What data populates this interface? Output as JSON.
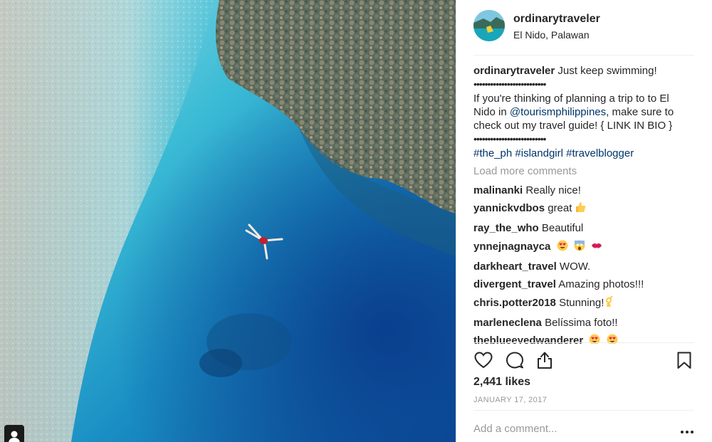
{
  "post": {
    "username": "ordinarytraveler",
    "location": "El Nido, Palawan",
    "caption": {
      "username": "ordinarytraveler",
      "line1": "Just keep swimming!",
      "dots": "••••••••••••••••••••••••••",
      "line3": "If you're thinking of planning a trip to to El",
      "line4_prefix": "Nido in ",
      "mention": "@tourismphilippines",
      "line4_suffix": ", make sure to",
      "line5": "check out my travel guide! { LINK IN BIO }",
      "dots2": "••••••••••••••••••••••••••",
      "hashtags": [
        "#the_ph",
        "#islandgirl",
        "#travelblogger"
      ]
    },
    "load_more": "Load more comments",
    "comments": [
      {
        "user": "malinanki",
        "text": "Really nice!"
      },
      {
        "user": "yannickvdbos",
        "text": "great",
        "emoji": "thumbs-up"
      },
      {
        "user": "ray_the_who",
        "text": "Beautiful"
      },
      {
        "user": "ynnejnagnayca",
        "text": "",
        "emoji": "heart-eyes scream kiss"
      },
      {
        "user": "darkheart_travel",
        "text": "WOW."
      },
      {
        "user": "divergent_travel",
        "text": "Amazing photos!!!"
      },
      {
        "user": "chris.potter2018",
        "text": "Stunning!",
        "emoji": "ok-hand"
      },
      {
        "user": "marleneclena",
        "text": "Belíssima foto!!"
      },
      {
        "user": "theblueeyedwanderer",
        "text": "",
        "emoji": "heart-eyes heart-eyes"
      }
    ],
    "likes": "2,441 likes",
    "date": "JANUARY 17, 2017",
    "add_comment_placeholder": "Add a comment..."
  },
  "icons": {
    "like": "heart-icon",
    "comment": "comment-bubble-icon",
    "share": "share-icon",
    "save": "bookmark-icon",
    "more": "more-options-icon",
    "tag": "user-tag-icon"
  }
}
